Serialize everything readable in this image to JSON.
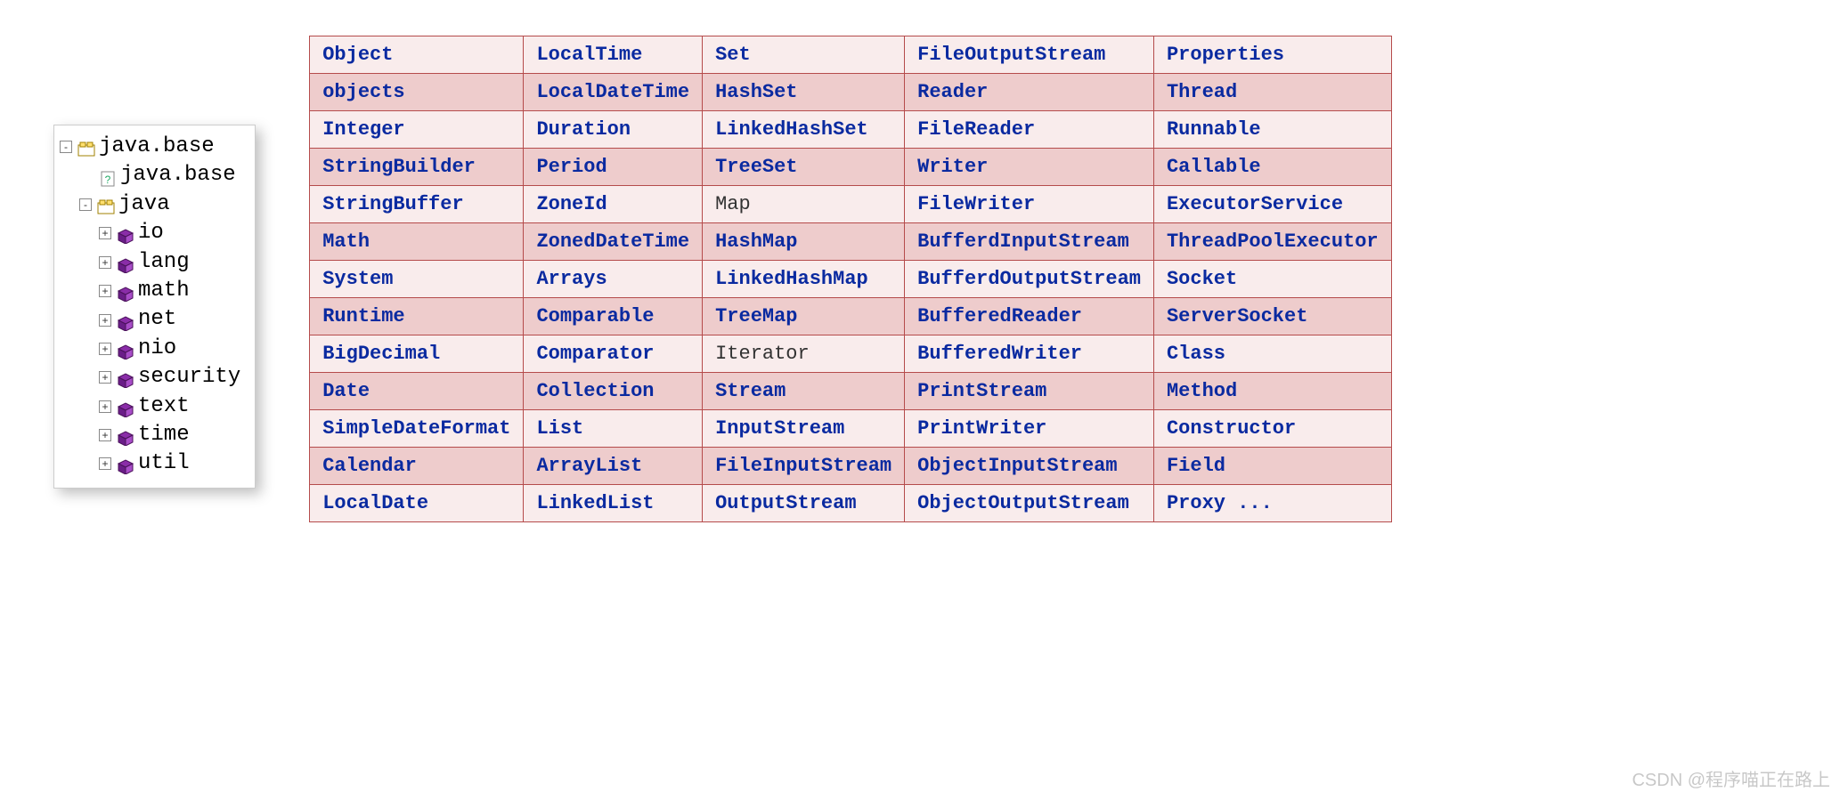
{
  "tree": {
    "root": {
      "exp": "-",
      "label": "java.base"
    },
    "sub": {
      "label": "java.base"
    },
    "java": {
      "exp": "-",
      "label": "java"
    },
    "packages": [
      {
        "exp": "+",
        "label": "io"
      },
      {
        "exp": "+",
        "label": "lang"
      },
      {
        "exp": "+",
        "label": "math"
      },
      {
        "exp": "+",
        "label": "net"
      },
      {
        "exp": "+",
        "label": "nio"
      },
      {
        "exp": "+",
        "label": "security"
      },
      {
        "exp": "+",
        "label": "text"
      },
      {
        "exp": "+",
        "label": "time"
      },
      {
        "exp": "+",
        "label": "util"
      }
    ]
  },
  "table": {
    "rows": [
      [
        {
          "t": "Object",
          "k": "lnk"
        },
        {
          "t": "LocalTime",
          "k": "lnk"
        },
        {
          "t": "Set",
          "k": "lnk"
        },
        {
          "t": "FileOutputStream",
          "k": "lnk"
        },
        {
          "t": "Properties",
          "k": "lnk"
        }
      ],
      [
        {
          "t": "objects",
          "k": "lnk"
        },
        {
          "t": "LocalDateTime",
          "k": "lnk"
        },
        {
          "t": "HashSet",
          "k": "lnk"
        },
        {
          "t": "Reader",
          "k": "lnk"
        },
        {
          "t": "Thread",
          "k": "lnk"
        }
      ],
      [
        {
          "t": "Integer",
          "k": "lnk"
        },
        {
          "t": "Duration",
          "k": "lnk"
        },
        {
          "t": "LinkedHashSet",
          "k": "lnk"
        },
        {
          "t": "FileReader",
          "k": "lnk"
        },
        {
          "t": "Runnable",
          "k": "lnk"
        }
      ],
      [
        {
          "t": "StringBuilder",
          "k": "lnk"
        },
        {
          "t": "Period",
          "k": "lnk"
        },
        {
          "t": "TreeSet",
          "k": "lnk"
        },
        {
          "t": "Writer",
          "k": "lnk"
        },
        {
          "t": "Callable",
          "k": "lnk"
        }
      ],
      [
        {
          "t": "StringBuffer",
          "k": "lnk"
        },
        {
          "t": "ZoneId",
          "k": "lnk"
        },
        {
          "t": "Map",
          "k": "plain"
        },
        {
          "t": "FileWriter",
          "k": "lnk"
        },
        {
          "t": "ExecutorService",
          "k": "lnk"
        }
      ],
      [
        {
          "t": "Math",
          "k": "lnk"
        },
        {
          "t": "ZonedDateTime",
          "k": "lnk"
        },
        {
          "t": "HashMap",
          "k": "lnk"
        },
        {
          "t": "BufferdInputStream",
          "k": "lnk"
        },
        {
          "t": "ThreadPoolExecutor",
          "k": "lnk"
        }
      ],
      [
        {
          "t": "System",
          "k": "lnk"
        },
        {
          "t": "Arrays",
          "k": "lnk"
        },
        {
          "t": "LinkedHashMap",
          "k": "lnk"
        },
        {
          "t": "BufferdOutputStream",
          "k": "lnk"
        },
        {
          "t": "Socket",
          "k": "lnk"
        }
      ],
      [
        {
          "t": "Runtime",
          "k": "lnk"
        },
        {
          "t": "Comparable",
          "k": "lnk"
        },
        {
          "t": "TreeMap",
          "k": "lnk"
        },
        {
          "t": "BufferedReader",
          "k": "lnk"
        },
        {
          "t": "ServerSocket",
          "k": "lnk"
        }
      ],
      [
        {
          "t": "BigDecimal",
          "k": "lnk"
        },
        {
          "t": "Comparator",
          "k": "lnk"
        },
        {
          "t": "Iterator",
          "k": "plain"
        },
        {
          "t": "BufferedWriter",
          "k": "lnk"
        },
        {
          "t": "Class",
          "k": "lnk"
        }
      ],
      [
        {
          "t": "Date",
          "k": "lnk"
        },
        {
          "t": "Collection",
          "k": "lnk"
        },
        {
          "t": "Stream",
          "k": "lnk"
        },
        {
          "t": "PrintStream",
          "k": "lnk"
        },
        {
          "t": "Method",
          "k": "lnk"
        }
      ],
      [
        {
          "t": "SimpleDateFormat",
          "k": "lnk"
        },
        {
          "t": "List",
          "k": "lnk"
        },
        {
          "t": "InputStream",
          "k": "lnk"
        },
        {
          "t": "PrintWriter",
          "k": "lnk"
        },
        {
          "t": "Constructor",
          "k": "lnk"
        }
      ],
      [
        {
          "t": "Calendar",
          "k": "lnk"
        },
        {
          "t": "ArrayList",
          "k": "lnk"
        },
        {
          "t": "FileInputStream",
          "k": "lnk"
        },
        {
          "t": "ObjectInputStream",
          "k": "lnk"
        },
        {
          "t": "Field",
          "k": "lnk"
        }
      ],
      [
        {
          "t": "LocalDate",
          "k": "lnk"
        },
        {
          "t": "LinkedList",
          "k": "lnk"
        },
        {
          "t": "OutputStream",
          "k": "lnk"
        },
        {
          "t": "ObjectOutputStream",
          "k": "lnk"
        },
        {
          "t": "Proxy ...",
          "k": "lnk"
        }
      ]
    ]
  },
  "watermark": "CSDN @程序喵正在路上"
}
